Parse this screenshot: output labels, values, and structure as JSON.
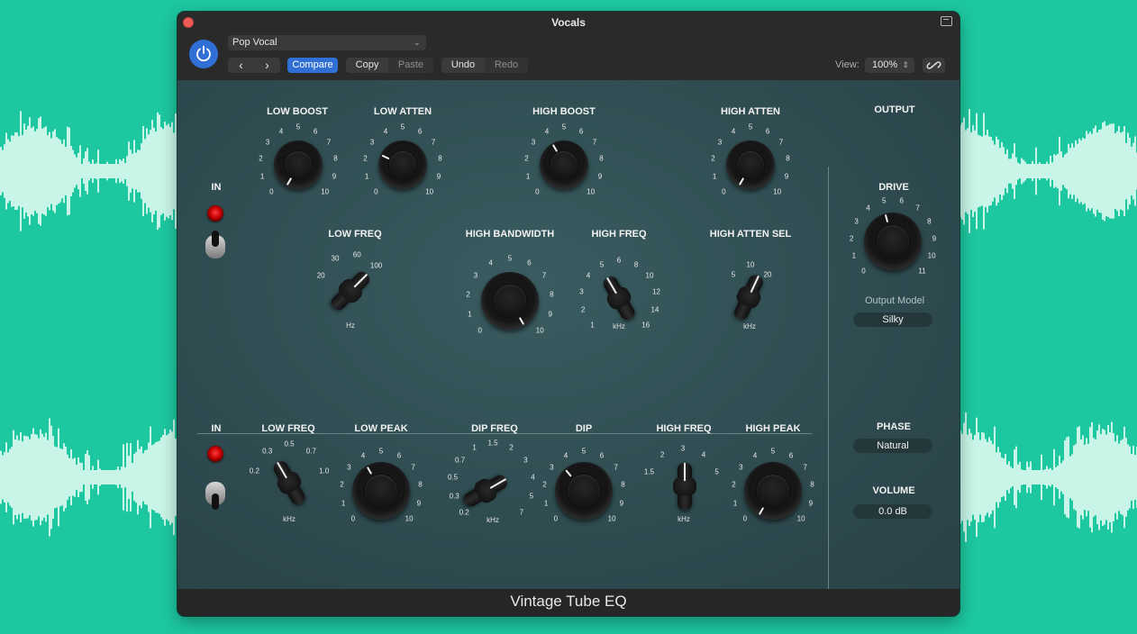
{
  "window": {
    "title": "Vocals",
    "footer_title": "Vintage Tube EQ"
  },
  "toolbar": {
    "preset": "Pop Vocal",
    "prev_icon": "‹",
    "next_icon": "›",
    "compare": "Compare",
    "copy": "Copy",
    "paste": "Paste",
    "undo": "Undo",
    "redo": "Redo",
    "view_label": "View:",
    "zoom": "100%"
  },
  "low_section": {
    "in_label": "IN",
    "low_boost": {
      "label": "LOW BOOST",
      "ticks": [
        "0",
        "1",
        "2",
        "3",
        "4",
        "5",
        "6",
        "7",
        "8",
        "9",
        "10"
      ]
    },
    "low_atten": {
      "label": "LOW ATTEN",
      "ticks": [
        "0",
        "1",
        "2",
        "3",
        "4",
        "5",
        "6",
        "7",
        "8",
        "9",
        "10"
      ]
    },
    "high_boost": {
      "label": "HIGH BOOST",
      "ticks": [
        "0",
        "1",
        "2",
        "3",
        "4",
        "5",
        "6",
        "7",
        "8",
        "9",
        "10"
      ]
    },
    "high_atten": {
      "label": "HIGH ATTEN",
      "ticks": [
        "0",
        "1",
        "2",
        "3",
        "4",
        "5",
        "6",
        "7",
        "8",
        "9",
        "10"
      ]
    },
    "low_freq": {
      "label": "LOW FREQ",
      "ticks": [
        "20",
        "30",
        "60",
        "100"
      ],
      "unit": "Hz"
    },
    "high_bandwidth": {
      "label": "HIGH BANDWIDTH",
      "ticks": [
        "0",
        "1",
        "2",
        "3",
        "4",
        "5",
        "6",
        "7",
        "8",
        "9",
        "10"
      ]
    },
    "high_freq": {
      "label": "HIGH FREQ",
      "ticks": [
        "1",
        "2",
        "3",
        "4",
        "5",
        "6",
        "8",
        "10",
        "12",
        "14",
        "16"
      ],
      "unit": "kHz"
    },
    "high_atten_sel": {
      "label": "HIGH ATTEN SEL",
      "ticks": [
        "5",
        "10",
        "20"
      ],
      "unit": "kHz"
    }
  },
  "mid_section": {
    "in_label": "IN",
    "low_freq": {
      "label": "LOW FREQ",
      "ticks": [
        "0.2",
        "0.3",
        "0.5",
        "0.7",
        "1.0"
      ],
      "unit": "kHz"
    },
    "low_peak": {
      "label": "LOW PEAK",
      "ticks": [
        "0",
        "1",
        "2",
        "3",
        "4",
        "5",
        "6",
        "7",
        "8",
        "9",
        "10"
      ]
    },
    "dip_freq": {
      "label": "DIP FREQ",
      "ticks": [
        "0.2",
        "0.3",
        "0.5",
        "0.7",
        "1",
        "1.5",
        "2",
        "3",
        "4",
        "5",
        "7"
      ],
      "unit": "kHz"
    },
    "dip": {
      "label": "DIP",
      "ticks": [
        "0",
        "1",
        "2",
        "3",
        "4",
        "5",
        "6",
        "7",
        "8",
        "9",
        "10"
      ]
    },
    "high_freq": {
      "label": "HIGH FREQ",
      "ticks": [
        "1.5",
        "2",
        "3",
        "4",
        "5"
      ],
      "unit": "kHz"
    },
    "high_peak": {
      "label": "HIGH PEAK",
      "ticks": [
        "0",
        "1",
        "2",
        "3",
        "4",
        "5",
        "6",
        "7",
        "8",
        "9",
        "10"
      ]
    }
  },
  "output": {
    "label": "OUTPUT",
    "drive": {
      "label": "DRIVE",
      "ticks": [
        "0",
        "1",
        "2",
        "3",
        "4",
        "5",
        "6",
        "7",
        "8",
        "9",
        "10",
        "11"
      ]
    },
    "output_model_label": "Output Model",
    "output_model": "Silky",
    "phase_label": "PHASE",
    "phase": "Natural",
    "volume_label": "VOLUME",
    "volume": "0.0 dB"
  },
  "colors": {
    "background": "#1dc7a0",
    "panel": "#2f4c51",
    "accent": "#2f6fd6",
    "led": "#ff2a2a",
    "waveform": "#c8f5e8"
  }
}
